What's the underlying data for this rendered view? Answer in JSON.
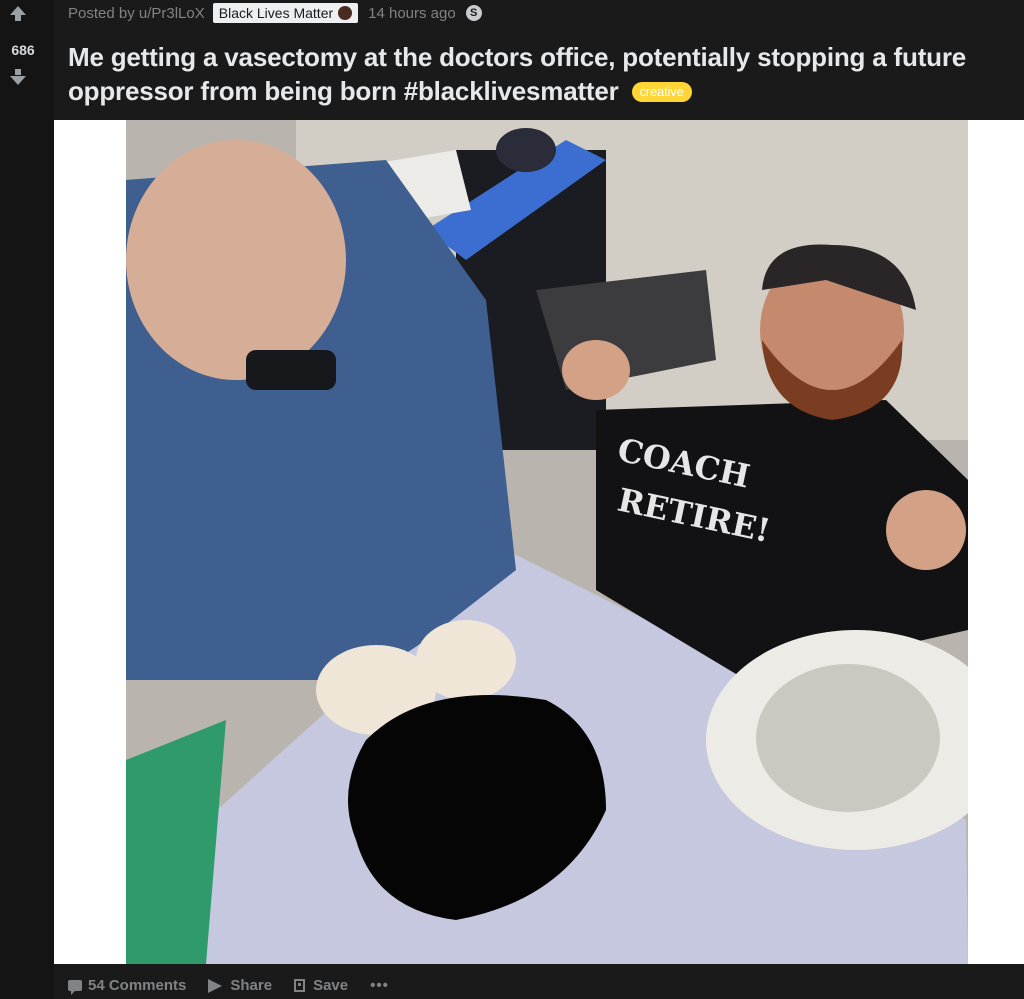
{
  "post": {
    "score": "686",
    "posted_by": "Posted by u/Pr3lLoX",
    "user_flair": "Black Lives Matter",
    "time": "14 hours ago",
    "silver_award": "S",
    "title": "Me getting a vasectomy at the doctors office, potentially stopping a future oppressor from being born #blacklivesmatter",
    "post_flair": "creative",
    "photo_caption": "Doctor performing vasectomy on smiling bearded man giving thumbs up",
    "shirt_text_1": "COACH",
    "shirt_text_2": "RETIRE!"
  },
  "footer": {
    "comments": "54 Comments",
    "share": "Share",
    "save": "Save",
    "more": "•••"
  },
  "colors": {
    "background": "#1a1a1b",
    "vote_column": "#141415",
    "post_flair": "#ffd635",
    "user_flair_bg": "#edeff1"
  },
  "icons": {
    "upvote": "arrow-up-icon",
    "downvote": "arrow-down-icon",
    "comment": "comment-icon",
    "share": "share-icon",
    "save": "save-icon"
  }
}
